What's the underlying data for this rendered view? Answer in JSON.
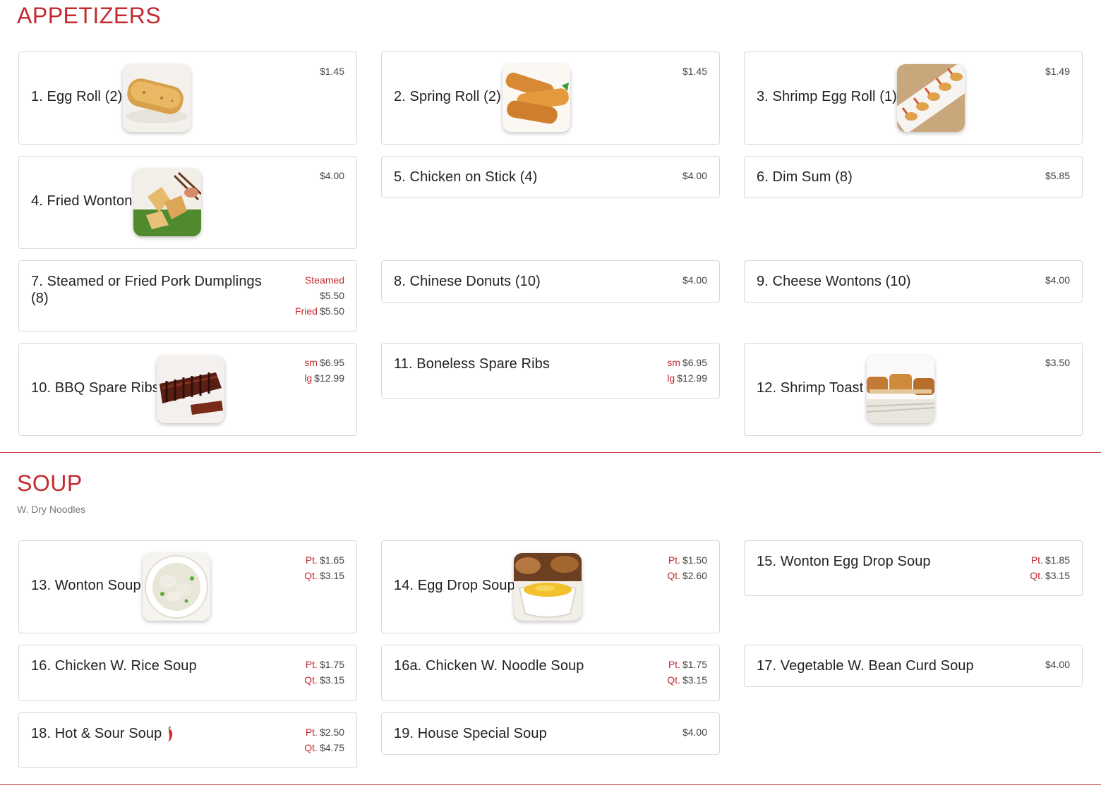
{
  "appetizers": {
    "title": "APPETIZERS",
    "items": [
      {
        "name": "1. Egg Roll (2)",
        "prices": [
          {
            "label": "",
            "value": "$1.45"
          }
        ]
      },
      {
        "name": "2. Spring Roll (2)",
        "prices": [
          {
            "label": "",
            "value": "$1.45"
          }
        ]
      },
      {
        "name": "3. Shrimp Egg Roll (1)",
        "prices": [
          {
            "label": "",
            "value": "$1.49"
          }
        ]
      },
      {
        "name": "4. Fried Wonton",
        "prices": [
          {
            "label": "",
            "value": "$4.00"
          }
        ]
      },
      {
        "name": "5. Chicken on Stick (4)",
        "prices": [
          {
            "label": "",
            "value": "$4.00"
          }
        ]
      },
      {
        "name": "6. Dim Sum (8)",
        "prices": [
          {
            "label": "",
            "value": "$5.85"
          }
        ]
      },
      {
        "name": "7. Steamed or Fried Pork Dumplings (8)",
        "prices": [
          {
            "label": "Steamed",
            "value": ""
          },
          {
            "label": "",
            "value": "$5.50"
          },
          {
            "label": "Fried",
            "value": "$5.50"
          }
        ]
      },
      {
        "name": "8. Chinese Donuts (10)",
        "prices": [
          {
            "label": "",
            "value": "$4.00"
          }
        ]
      },
      {
        "name": "9. Cheese Wontons (10)",
        "prices": [
          {
            "label": "",
            "value": "$4.00"
          }
        ]
      },
      {
        "name": "10. BBQ Spare Ribs",
        "prices": [
          {
            "label": "sm",
            "value": "$6.95"
          },
          {
            "label": "lg",
            "value": "$12.99"
          }
        ]
      },
      {
        "name": "11. Boneless Spare Ribs",
        "prices": [
          {
            "label": "sm",
            "value": "$6.95"
          },
          {
            "label": "lg",
            "value": "$12.99"
          }
        ]
      },
      {
        "name": "12. Shrimp Toast",
        "prices": [
          {
            "label": "",
            "value": "$3.50"
          }
        ]
      }
    ]
  },
  "soup": {
    "title": "SOUP",
    "subtitle": "W. Dry Noodles",
    "items": [
      {
        "name": "13. Wonton Soup",
        "prices": [
          {
            "label": "Pt.",
            "value": "$1.65"
          },
          {
            "label": "Qt.",
            "value": "$3.15"
          }
        ]
      },
      {
        "name": "14. Egg Drop Soup",
        "prices": [
          {
            "label": "Pt.",
            "value": "$1.50"
          },
          {
            "label": "Qt.",
            "value": "$2.60"
          }
        ]
      },
      {
        "name": "15. Wonton Egg Drop Soup",
        "prices": [
          {
            "label": "Pt.",
            "value": "$1.85"
          },
          {
            "label": "Qt.",
            "value": "$3.15"
          }
        ]
      },
      {
        "name": "16. Chicken W. Rice Soup",
        "prices": [
          {
            "label": "Pt.",
            "value": "$1.75"
          },
          {
            "label": "Qt.",
            "value": "$3.15"
          }
        ]
      },
      {
        "name": "16a. Chicken W. Noodle Soup",
        "prices": [
          {
            "label": "Pt.",
            "value": "$1.75"
          },
          {
            "label": "Qt.",
            "value": "$3.15"
          }
        ]
      },
      {
        "name": "17. Vegetable W. Bean Curd Soup",
        "prices": [
          {
            "label": "",
            "value": "$4.00"
          }
        ]
      },
      {
        "name": "18. Hot & Sour Soup",
        "prices": [
          {
            "label": "Pt.",
            "value": "$2.50"
          },
          {
            "label": "Qt.",
            "value": "$4.75"
          }
        ],
        "icon": "chili-pepper-icon"
      },
      {
        "name": "19. House Special Soup",
        "prices": [
          {
            "label": "",
            "value": "$4.00"
          }
        ]
      }
    ]
  },
  "colors": {
    "accent": "#c42a2f",
    "border": "#d9d9d9",
    "text": "#222222"
  }
}
